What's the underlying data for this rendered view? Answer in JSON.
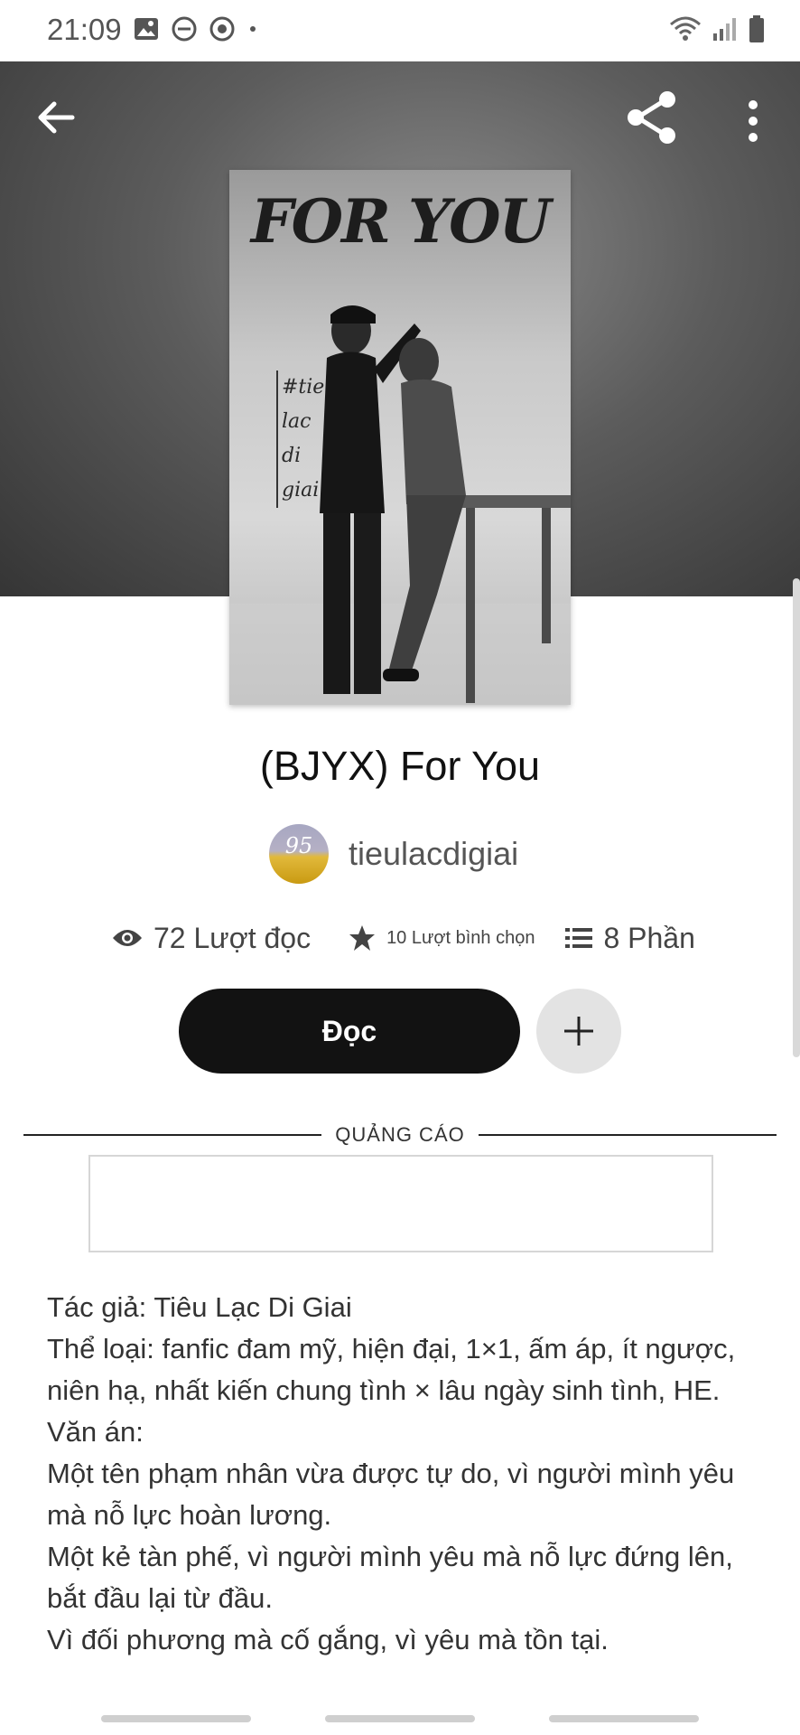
{
  "status_bar": {
    "time": "21:09",
    "left_icons": [
      "image-icon",
      "do-not-disturb-icon",
      "circle-status-icon",
      "dot-icon"
    ],
    "right_icons": [
      "wifi-icon",
      "signal-icon",
      "battery-icon"
    ]
  },
  "header": {
    "back_icon": "arrow-left-icon",
    "share_icon": "share-icon",
    "more_icon": "more-vertical-icon"
  },
  "cover": {
    "title_text": "FOR YOU",
    "side_text": [
      "#tieu",
      "lac",
      "di",
      "giai"
    ]
  },
  "book": {
    "title": "(BJYX) For You",
    "author": "tieulacdigiai",
    "avatar_text": "95"
  },
  "stats": {
    "views": "72 Lượt đọc",
    "votes": "10 Lượt bình chọn",
    "parts": "8 Phần"
  },
  "actions": {
    "read_label": "Đọc",
    "add_icon": "plus-icon"
  },
  "ad": {
    "label": "QUẢNG CÁO"
  },
  "description": {
    "lines": [
      "Tác giả: Tiêu Lạc Di Giai",
      "Thể loại: fanfic đam mỹ, hiện đại, 1×1, ấm áp, ít ngược, niên hạ, nhất kiến chung tình × lâu ngày sinh tình, HE.",
      "Văn án:",
      "Một tên phạm nhân vừa được tự do, vì người mình yêu mà nỗ lực hoàn lương.",
      "Một kẻ tàn phế, vì người mình yêu mà nỗ lực đứng lên, bắt đầu lại từ đầu.",
      "Vì đối phương mà cố gắng, vì yêu mà tồn tại."
    ]
  },
  "colors": {
    "header_dark": "#353535",
    "read_button": "#121212",
    "add_button": "#e3e3e3",
    "avatar_gold": "#e1b93b"
  }
}
